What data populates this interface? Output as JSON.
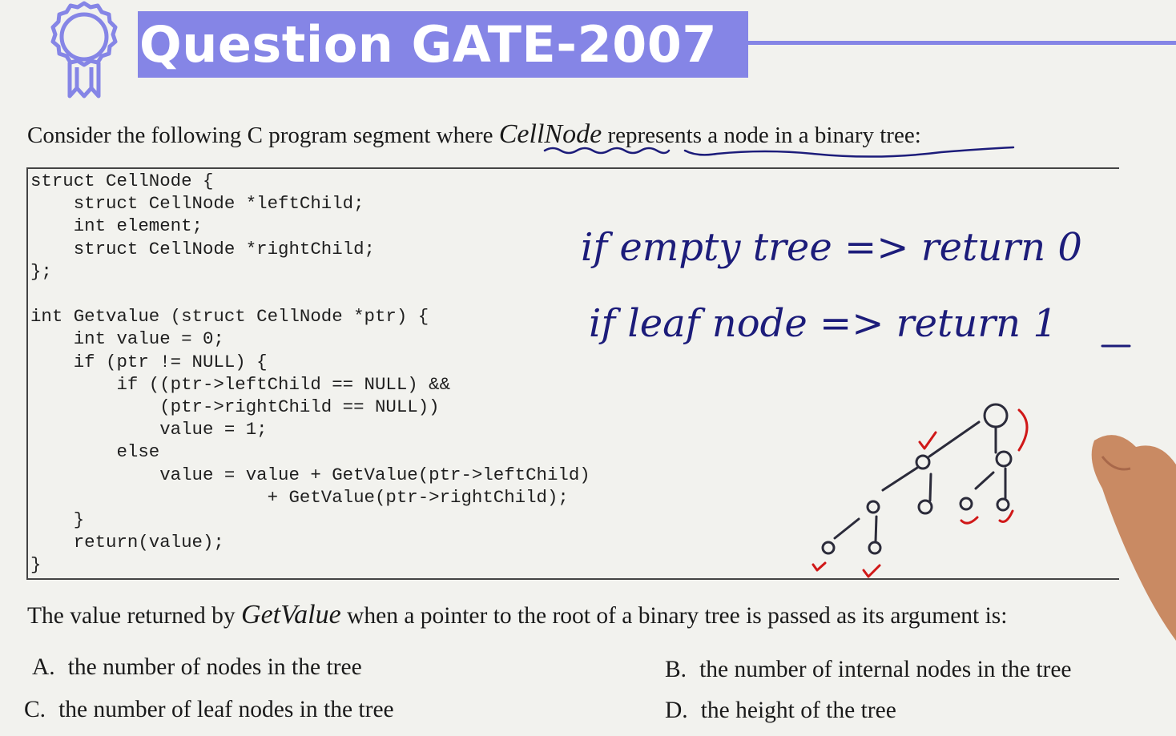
{
  "header": {
    "title": "Question GATE-2007",
    "accent_color": "#8585e6",
    "icon": "award-ribbon-icon"
  },
  "intro": {
    "before": "Consider the following C program segment where ",
    "struct_name": "CellNode",
    "after": " represents a node in a binary tree:"
  },
  "code": "struct CellNode {\n    struct CellNode *leftChild;\n    int element;\n    struct CellNode *rightChild;\n};\n\nint Getvalue (struct CellNode *ptr) {\n    int value = 0;\n    if (ptr != NULL) {\n        if ((ptr->leftChild == NULL) &&\n            (ptr->rightChild == NULL))\n            value = 1;\n        else\n            value = value + GetValue(ptr->leftChild)\n                      + GetValue(ptr->rightChild);\n    }\n    return(value);\n}",
  "question": {
    "before": "The value returned by ",
    "fn_name": "GetValue",
    "after": " when a pointer to the root of a binary tree is passed as its argument is:"
  },
  "options": [
    {
      "letter": "A.",
      "text": "the number of nodes in the tree"
    },
    {
      "letter": "B.",
      "text": "the number of internal nodes in the tree"
    },
    {
      "letter": "C.",
      "text": "the number of leaf nodes in the tree"
    },
    {
      "letter": "D.",
      "text": "the height of the tree"
    }
  ],
  "annotations": {
    "line1": "if empty tree => return 0",
    "line2": "if leaf node => return 1",
    "ink_color": "#1c1c7a",
    "tree_color": "#2b2b3a",
    "check_color": "#d01818"
  }
}
